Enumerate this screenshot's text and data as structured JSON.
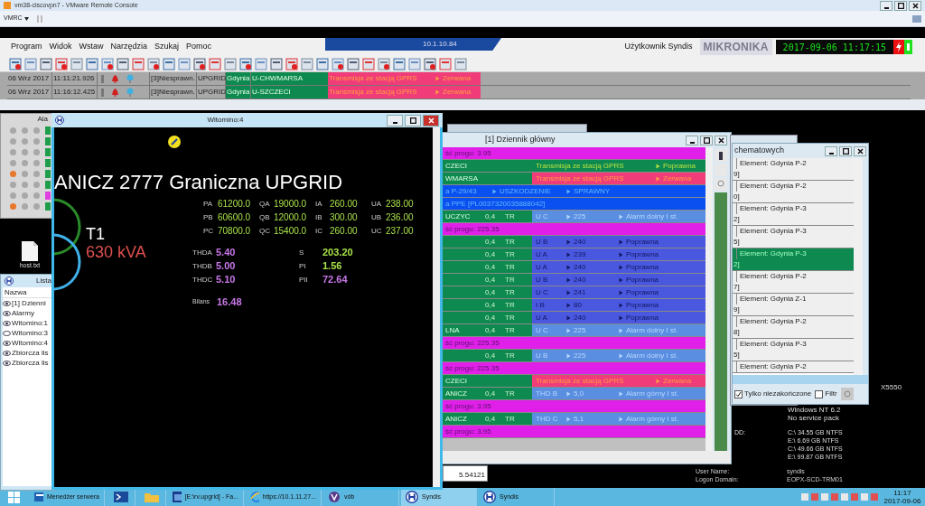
{
  "vmware": {
    "title": "vm38-ciscovpn7 - VMware Remote Console",
    "menu": "VMRC"
  },
  "app": {
    "menus": [
      "Program",
      "Widok",
      "Wstaw",
      "Narzędzia",
      "Szukaj",
      "Pomoc"
    ],
    "connection": "10.1.10.84",
    "user": "Użytkownik Syndis",
    "logo": "MIKRONIKA",
    "clock": "2017-09-06 11:17:15"
  },
  "alarms": [
    {
      "date": "06 Wrz 2017",
      "time": "11:11:21.926",
      "status": "[3]Niesprawn.",
      "system": "UPGRID",
      "city": "Gdynia",
      "station": "U-CHWMARSA",
      "event": "Transmisja ze stacją GPRS",
      "state": "Zerwana"
    },
    {
      "date": "06 Wrz 2017",
      "time": "11:16:12.425",
      "status": "[3]Niesprawn.",
      "system": "UPGRID",
      "city": "Gdynia",
      "station": "U-SZCZECI",
      "event": "Transmisja ze stacją GPRS",
      "state": "Zerwana"
    }
  ],
  "alarm_window": {
    "title": "Ala",
    "rows": [
      {
        "color": "#a8a8a8"
      },
      {
        "color": "#a8a8a8"
      },
      {
        "color": "#a8a8a8"
      },
      {
        "color": "#a8a8a8"
      },
      {
        "color": "#e8782c"
      },
      {
        "color": "#a8a8a8"
      },
      {
        "color": "#a8a8a8"
      },
      {
        "color": "#e8782c"
      }
    ],
    "tags": [
      {
        "color": "#1e9e4a"
      },
      {
        "color": "#1e9e4a"
      },
      {
        "color": "#1e9e4a"
      },
      {
        "color": "#1e9e4a"
      },
      {
        "color": "#1e9e4a"
      },
      {
        "color": "#1e9e4a"
      },
      {
        "color": "#e040e0"
      },
      {
        "color": "#1e9e4a"
      }
    ]
  },
  "desktop_file": "host.txt",
  "list_window": {
    "title": "Lista",
    "header": "Nazwa",
    "items": [
      {
        "label": "[1] Dzienni",
        "open": true
      },
      {
        "label": "Alarmy",
        "open": true
      },
      {
        "label": "Witomino:1",
        "open": true
      },
      {
        "label": "Witomino:3",
        "open": false
      },
      {
        "label": "Witomino:4",
        "open": true
      },
      {
        "label": "Zbiorcza lis",
        "open": true
      },
      {
        "label": "Zbiorcza lis",
        "open": true
      }
    ]
  },
  "witomino": {
    "title": "Witomino:4",
    "heading": "ANICZ 2777 Graniczna UPGRID",
    "transformer": "T1",
    "power": "630 kVA",
    "grid": [
      [
        {
          "label": "PA",
          "value": "61200.0"
        },
        {
          "label": "QA",
          "value": "19000.0"
        },
        {
          "label": "IA",
          "value": "260.00"
        },
        {
          "label": "UA",
          "value": "238.00"
        }
      ],
      [
        {
          "label": "PB",
          "value": "60600.0"
        },
        {
          "label": "QB",
          "value": "12000.0"
        },
        {
          "label": "IB",
          "value": "300.00"
        },
        {
          "label": "UB",
          "value": "236.00"
        }
      ],
      [
        {
          "label": "PC",
          "value": "70800.0"
        },
        {
          "label": "QC",
          "value": "15400.0"
        },
        {
          "label": "IC",
          "value": "260.00"
        },
        {
          "label": "UC",
          "value": "237.00"
        }
      ]
    ],
    "thd": [
      [
        {
          "label": "THDA",
          "value": "5.40",
          "color": "#c878e8"
        },
        {
          "label": "S",
          "value": "203.20",
          "color": "#a8e04a"
        }
      ],
      [
        {
          "label": "THDB",
          "value": "5.00",
          "color": "#c878e8"
        },
        {
          "label": "PI",
          "value": "1.56",
          "color": "#a8e04a"
        }
      ],
      [
        {
          "label": "THDC",
          "value": "5.10",
          "color": "#c878e8"
        },
        {
          "label": "PII",
          "value": "72.64",
          "color": "#c878e8"
        }
      ]
    ],
    "balance": {
      "label": "Bilans",
      "value": "16.48",
      "color": "#c878e8"
    }
  },
  "journal": {
    "title": "[1] Dziennik główny",
    "rows": [
      {
        "kind": "threshold",
        "text": "ść progu: 3.95"
      },
      {
        "kind": "gprs_ok",
        "station": "CZECI",
        "event": "Transmisja ze stacją GPRS",
        "state": "Poprawna"
      },
      {
        "kind": "gprs_fail",
        "station": "WMARSA",
        "event": "Transmisja ze stacją GPRS",
        "state": "Zerwana"
      },
      {
        "kind": "device",
        "station": "a P-29/43",
        "event": "USZKODZENIE",
        "state": "SPRAWNY"
      },
      {
        "kind": "ppe",
        "text": "a PPE [PL0037320035888042]"
      },
      {
        "kind": "alarm",
        "station": "UCZYC",
        "voltage": "0,4",
        "type": "TR",
        "param": "U C",
        "value": "225",
        "state": "Alarm dolny I st."
      },
      {
        "kind": "threshold",
        "text": "ść progu: 225.35"
      },
      {
        "kind": "normal",
        "voltage": "0,4",
        "type": "TR",
        "param": "U B",
        "value": "240",
        "state": "Poprawna"
      },
      {
        "kind": "normal",
        "voltage": "0,4",
        "type": "TR",
        "param": "U A",
        "value": "239",
        "state": "Poprawna"
      },
      {
        "kind": "normal",
        "voltage": "0,4",
        "type": "TR",
        "param": "U A",
        "value": "240",
        "state": "Poprawna"
      },
      {
        "kind": "normal",
        "voltage": "0,4",
        "type": "TR",
        "param": "U B",
        "value": "240",
        "state": "Poprawna"
      },
      {
        "kind": "normal",
        "voltage": "0,4",
        "type": "TR",
        "param": "U C",
        "value": "241",
        "state": "Poprawna"
      },
      {
        "kind": "normal",
        "voltage": "0,4",
        "type": "TR",
        "param": "I B",
        "value": "80",
        "state": "Poprawna"
      },
      {
        "kind": "normal",
        "voltage": "0,4",
        "type": "TR",
        "param": "U A",
        "value": "240",
        "state": "Poprawna"
      },
      {
        "kind": "alarm",
        "station": "LNA",
        "voltage": "0,4",
        "type": "TR",
        "param": "U C",
        "value": "225",
        "state": "Alarm dolny I st."
      },
      {
        "kind": "threshold",
        "text": "ść progu: 225.35"
      },
      {
        "kind": "alarm",
        "voltage": "0,4",
        "type": "TR",
        "param": "U B",
        "value": "225",
        "state": "Alarm dolny I st."
      },
      {
        "kind": "threshold",
        "text": "ść progu: 225.35"
      },
      {
        "kind": "gprs_fail",
        "station": "CZECI",
        "event": "Transmisja ze stacją GPRS",
        "state": "Zerwana"
      },
      {
        "kind": "alarm",
        "station": "ANICZ",
        "voltage": "0,4",
        "type": "TR",
        "param": "THD B",
        "value": "5,0",
        "state": "Alarm górny I st."
      },
      {
        "kind": "threshold",
        "text": "ść progu: 3.95"
      },
      {
        "kind": "alarm",
        "station": "ANICZ",
        "voltage": "0,4",
        "type": "TR",
        "param": "THD C",
        "value": "5,1",
        "state": "Alarm górny I st."
      },
      {
        "kind": "threshold",
        "text": "ść progu: 3.95"
      }
    ]
  },
  "below_value": "5.54121",
  "schema_window": {
    "title": "chematowych",
    "items": [
      {
        "element": "Element: Gdynia P-2",
        "code": "9]",
        "selected": false
      },
      {
        "element": "Element: Gdynia P-2",
        "code": "0]",
        "selected": false
      },
      {
        "element": "Element: Gdynia P-3",
        "code": "2]",
        "selected": false
      },
      {
        "element": "Element: Gdynia P-3",
        "code": "5]",
        "selected": false
      },
      {
        "element": "Element: Gdynia P-3",
        "code": "2]",
        "selected": true
      },
      {
        "element": "Element: Gdynia P-2",
        "code": "7]",
        "selected": false
      },
      {
        "element": "Element: Gdynia Z-1",
        "code": "9]",
        "selected": false
      },
      {
        "element": "Element: Gdynia P-2",
        "code": "8]",
        "selected": false
      },
      {
        "element": "Element: Gdynia P-3",
        "code": "5]",
        "selected": false
      },
      {
        "element": "Element: Gdynia P-2",
        "selected": false
      }
    ],
    "unfinished": {
      "label": "Tylko niezakończone",
      "checked": true
    },
    "filter": {
      "label": "Filtr",
      "checked": false
    }
  },
  "sysinfo": {
    "cpu": "X5550",
    "os": [
      "Windows NT 6.2",
      "No service pack"
    ],
    "disk_label": "DD:",
    "disks": [
      "C:\\ 34.55 GB NTFS",
      "E:\\ 6.69 GB NTFS",
      "C:\\ 49.66 GB NTFS",
      "E:\\ 99.87 GB NTFS"
    ],
    "user_label": "User Name:",
    "user": "syndis",
    "domain_label": "Logon Domain:",
    "domain": "EOPX-SCD-TRM01"
  },
  "taskbar": {
    "items": [
      {
        "kind": "server",
        "label": "Menedżer serwera",
        "selected": false
      },
      {
        "kind": "terminal",
        "selected": false
      },
      {
        "kind": "folder",
        "selected": false
      },
      {
        "kind": "app",
        "label": "[E:\\rv.upgrid] - Fa...",
        "selected": false
      },
      {
        "kind": "browser",
        "label": "https://10.1.11.27...",
        "selected": false
      },
      {
        "kind": "vdb",
        "label": "vdb",
        "selected": false
      },
      {
        "kind": "syndis",
        "label": "Syndis",
        "selected": true
      },
      {
        "kind": "syndis",
        "label": "Syndis",
        "selected": false
      }
    ],
    "time": "11:17",
    "date": "2017-09-06"
  }
}
